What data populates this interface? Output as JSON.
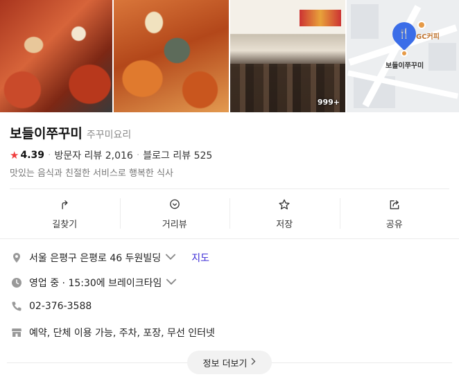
{
  "photos": {
    "count_badge": "999+"
  },
  "map": {
    "place_label": "보들이쭈꾸미",
    "nearby_label": "GC커피",
    "pin_color": "#3b6de8"
  },
  "place": {
    "name": "보들이쭈꾸미",
    "category": "주꾸미요리",
    "rating": "4.39",
    "visitor_reviews": "방문자 리뷰 2,016",
    "blog_reviews": "블로그 리뷰 525",
    "description": "맛있는 음식과 친절한 서비스로 행복한 식사"
  },
  "actions": [
    {
      "label": "길찾기",
      "icon": "directions-icon"
    },
    {
      "label": "거리뷰",
      "icon": "street-view-icon"
    },
    {
      "label": "저장",
      "icon": "star-icon"
    },
    {
      "label": "공유",
      "icon": "share-icon"
    }
  ],
  "info": {
    "address": "서울 은평구 은평로 46 두원빌딩",
    "map_link": "지도",
    "hours": "영업 중 · 15:30에 브레이크타임",
    "phone": "02-376-3588",
    "amenities": "예약, 단체 이용 가능, 주차, 포장, 무선 인터넷"
  },
  "more_button": "정보 더보기",
  "colors": {
    "star": "#f03e3e",
    "link": "#3b2bd6"
  }
}
